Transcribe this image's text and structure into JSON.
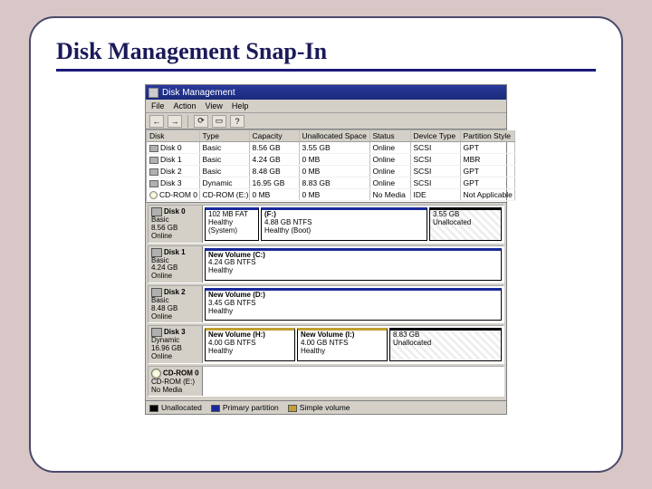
{
  "slide": {
    "title": "Disk Management Snap-In"
  },
  "titlebar": {
    "app_name": "Disk Management"
  },
  "menubar": {
    "file": "File",
    "action": "Action",
    "view": "View",
    "help": "Help"
  },
  "toolbar": {
    "back_glyph": "←",
    "fwd_glyph": "→",
    "refresh_glyph": "⟳",
    "props_glyph": "▭",
    "help_glyph": "?"
  },
  "table": {
    "headers": {
      "disk": "Disk",
      "type": "Type",
      "capacity": "Capacity",
      "unalloc": "Unallocated Space",
      "status": "Status",
      "devtype": "Device Type",
      "pstyle": "Partition Style"
    },
    "rows": [
      {
        "name": "Disk 0",
        "type": "Basic",
        "capacity": "8.56 GB",
        "unalloc": "3.55 GB",
        "status": "Online",
        "devtype": "SCSI",
        "pstyle": "GPT",
        "icon": "disk"
      },
      {
        "name": "Disk 1",
        "type": "Basic",
        "capacity": "4.24 GB",
        "unalloc": "0 MB",
        "status": "Online",
        "devtype": "SCSI",
        "pstyle": "MBR",
        "icon": "disk"
      },
      {
        "name": "Disk 2",
        "type": "Basic",
        "capacity": "8.48 GB",
        "unalloc": "0 MB",
        "status": "Online",
        "devtype": "SCSI",
        "pstyle": "GPT",
        "icon": "disk"
      },
      {
        "name": "Disk 3",
        "type": "Dynamic",
        "capacity": "16.95 GB",
        "unalloc": "8.83 GB",
        "status": "Online",
        "devtype": "SCSI",
        "pstyle": "GPT",
        "icon": "disk"
      },
      {
        "name": "CD-ROM 0",
        "type": "CD-ROM (E:)",
        "capacity": "0 MB",
        "unalloc": "0 MB",
        "status": "No Media",
        "devtype": "IDE",
        "pstyle": "Not Applicable",
        "icon": "cd"
      }
    ]
  },
  "graph": {
    "disk0": {
      "header_name": "Disk 0",
      "header_type": "Basic",
      "header_size": "8.56 GB",
      "header_status": "Online",
      "vol0": {
        "name": "",
        "size": "102 MB FAT",
        "status": "Healthy (System)"
      },
      "vol1": {
        "name": "(F:)",
        "size": "4.88 GB NTFS",
        "status": "Healthy (Boot)"
      },
      "vol2": {
        "name": "",
        "size": "3.55 GB",
        "status": "Unallocated"
      }
    },
    "disk1": {
      "header_name": "Disk 1",
      "header_type": "Basic",
      "header_size": "4.24 GB",
      "header_status": "Online",
      "vol0": {
        "name": "New Volume  (C:)",
        "size": "4.24 GB NTFS",
        "status": "Healthy"
      }
    },
    "disk2": {
      "header_name": "Disk 2",
      "header_type": "Basic",
      "header_size": "8.48 GB",
      "header_status": "Online",
      "vol0": {
        "name": "New Volume  (D:)",
        "size": "3.45 GB NTFS",
        "status": "Healthy"
      }
    },
    "disk3": {
      "header_name": "Disk 3",
      "header_type": "Dynamic",
      "header_size": "16.96 GB",
      "header_status": "Online",
      "vol0": {
        "name": "New Volume (H:)",
        "size": "4.00 GB NTFS",
        "status": "Healthy"
      },
      "vol1": {
        "name": "New Volume (I:)",
        "size": "4.00 GB NTFS",
        "status": "Healthy"
      },
      "vol2": {
        "name": "",
        "size": "8.83 GB",
        "status": "Unallocated"
      }
    },
    "cdrom": {
      "header_name": "CD-ROM 0",
      "header_type": "CD-ROM (E:)",
      "header_status": "No Media"
    }
  },
  "legend": {
    "unallocated": "Unallocated",
    "primary": "Primary partition",
    "simple": "Simple volume"
  }
}
